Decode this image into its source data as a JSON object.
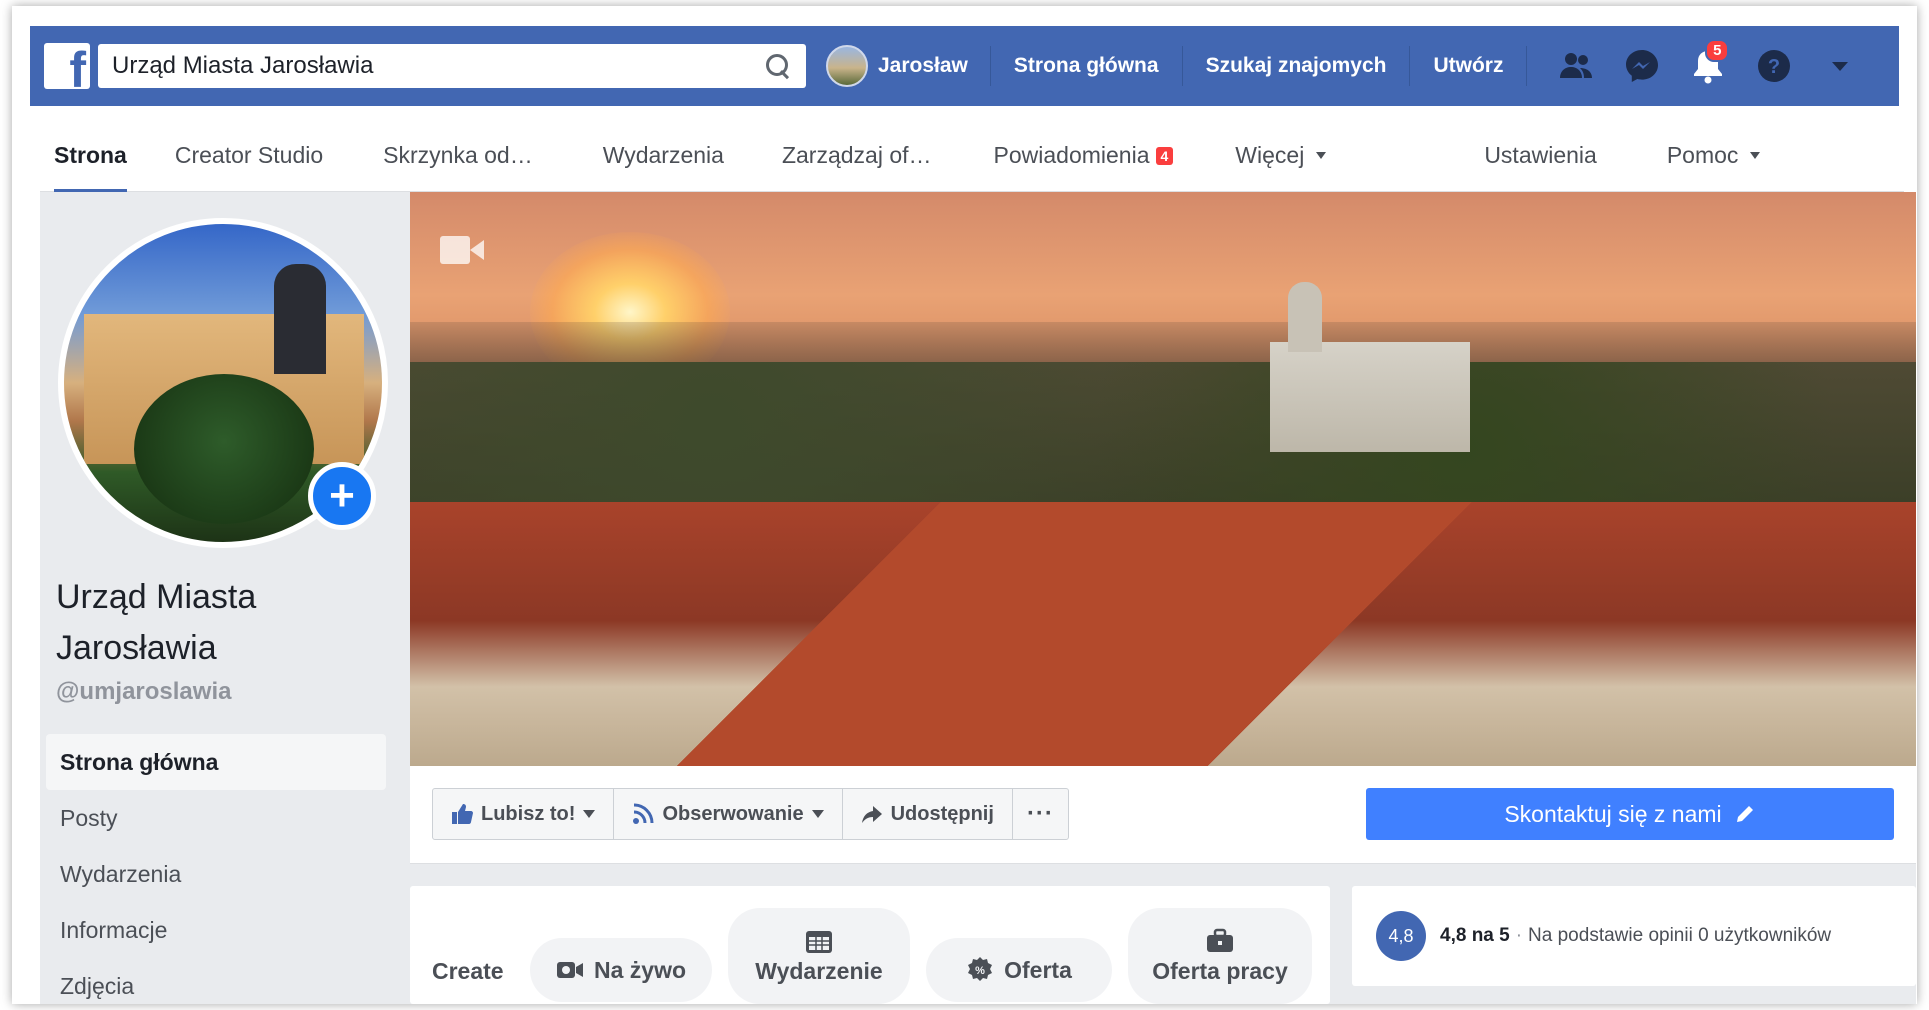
{
  "topbar": {
    "logo": "f",
    "search_value": "Urząd Miasta Jarosławia",
    "user_name": "Jarosław",
    "links": [
      "Strona główna",
      "Szukaj znajomych",
      "Utwórz"
    ],
    "notification_count": "5",
    "icons": [
      "friends-icon",
      "messenger-icon",
      "notifications-icon",
      "help-icon",
      "dropdown-icon"
    ]
  },
  "tabs": {
    "items": [
      {
        "label": "Strona"
      },
      {
        "label": "Creator Studio"
      },
      {
        "label": "Skrzynka od…"
      },
      {
        "label": "Wydarzenia"
      },
      {
        "label": "Zarządzaj of…"
      },
      {
        "label": "Powiadomienia",
        "badge": "4"
      },
      {
        "label": "Więcej"
      },
      {
        "label": "Ustawienia"
      },
      {
        "label": "Pomoc"
      }
    ]
  },
  "sidebar": {
    "page_name": "Urząd Miasta Jarosławia",
    "handle": "@umjaroslawia",
    "nav": [
      "Strona główna",
      "Posty",
      "Wydarzenia",
      "Informacje",
      "Zdjęcia"
    ]
  },
  "actions": {
    "like": "Lubisz to!",
    "follow": "Obserwowanie",
    "share": "Udostępnij",
    "more": "···",
    "contact": "Skontaktuj się z nami"
  },
  "create": {
    "label": "Create",
    "live": "Na żywo",
    "event": "Wydarzenie",
    "offer": "Oferta",
    "job": "Oferta pracy"
  },
  "rating": {
    "badge": "4,8",
    "score": "4,8 na 5",
    "separator": "·",
    "text": "Na podstawie opinii 0 użytkowników"
  },
  "colors": {
    "brand_blue": "#4267b2",
    "contact_blue": "#4080ff",
    "badge_red": "#fa3e3e"
  }
}
